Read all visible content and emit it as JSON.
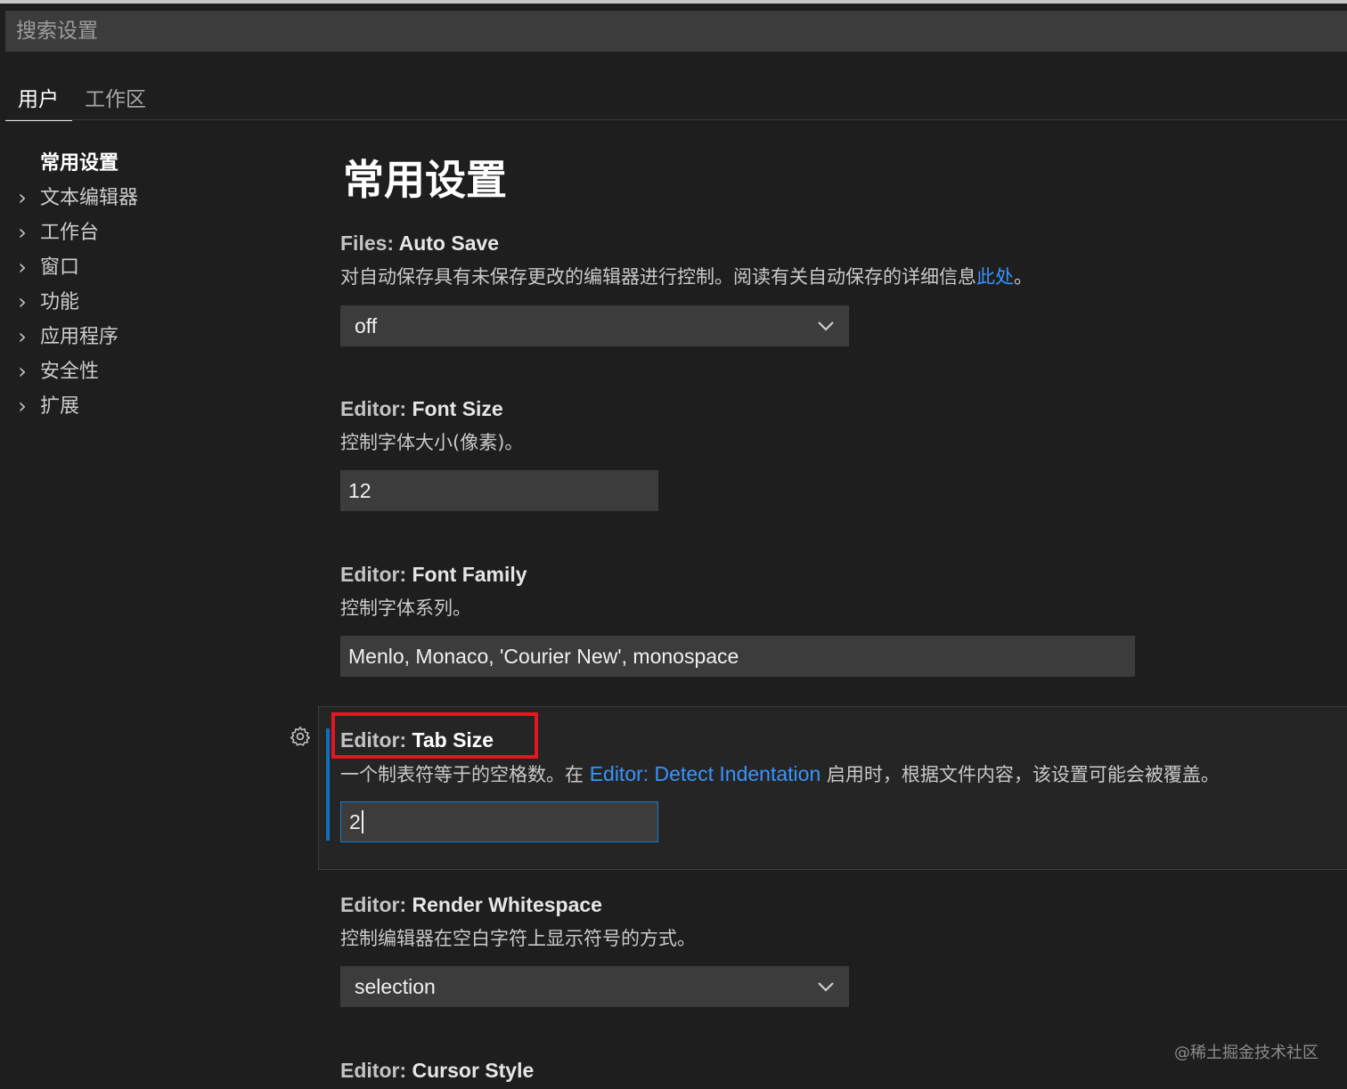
{
  "search": {
    "placeholder": "搜索设置"
  },
  "tabs": [
    {
      "label": "用户"
    },
    {
      "label": "工作区"
    }
  ],
  "toc": [
    {
      "label": "常用设置"
    },
    {
      "label": "文本编辑器"
    },
    {
      "label": "工作台"
    },
    {
      "label": "窗口"
    },
    {
      "label": "功能"
    },
    {
      "label": "应用程序"
    },
    {
      "label": "安全性"
    },
    {
      "label": "扩展"
    }
  ],
  "page_title": "常用设置",
  "settings": {
    "auto_save": {
      "category": "Files: ",
      "name": "Auto Save",
      "desc": "对自动保存具有未保存更改的编辑器进行控制。阅读有关自动保存的详细信息",
      "link": "此处",
      "desc_end": "。",
      "value": "off"
    },
    "font_size": {
      "category": "Editor: ",
      "name": "Font Size",
      "desc": "控制字体大小(像素)。",
      "value": "12"
    },
    "font_family": {
      "category": "Editor: ",
      "name": "Font Family",
      "desc": "控制字体系列。",
      "value": "Menlo, Monaco, 'Courier New', monospace"
    },
    "tab_size": {
      "category": "Editor: ",
      "name": "Tab Size",
      "desc": "一个制表符等于的空格数。在 ",
      "link": "Editor: Detect Indentation",
      "desc_end": " 启用时，根据文件内容，该设置可能会被覆盖。",
      "value": "2"
    },
    "render_whitespace": {
      "category": "Editor: ",
      "name": "Render Whitespace",
      "desc": "控制编辑器在空白字符上显示符号的方式。",
      "value": "selection"
    },
    "cursor_style": {
      "category": "Editor: ",
      "name": "Cursor Style"
    }
  },
  "watermark": "@稀土掘金技术社区",
  "colors": {
    "background": "#1e1e1e",
    "accent": "#0e70c0",
    "link": "#3794ff",
    "highlight": "#e5161f"
  },
  "icons": {
    "toc_chevron": "chevron-right-icon",
    "select_chevron": "chevron-down-icon",
    "gear": "gear-icon"
  }
}
